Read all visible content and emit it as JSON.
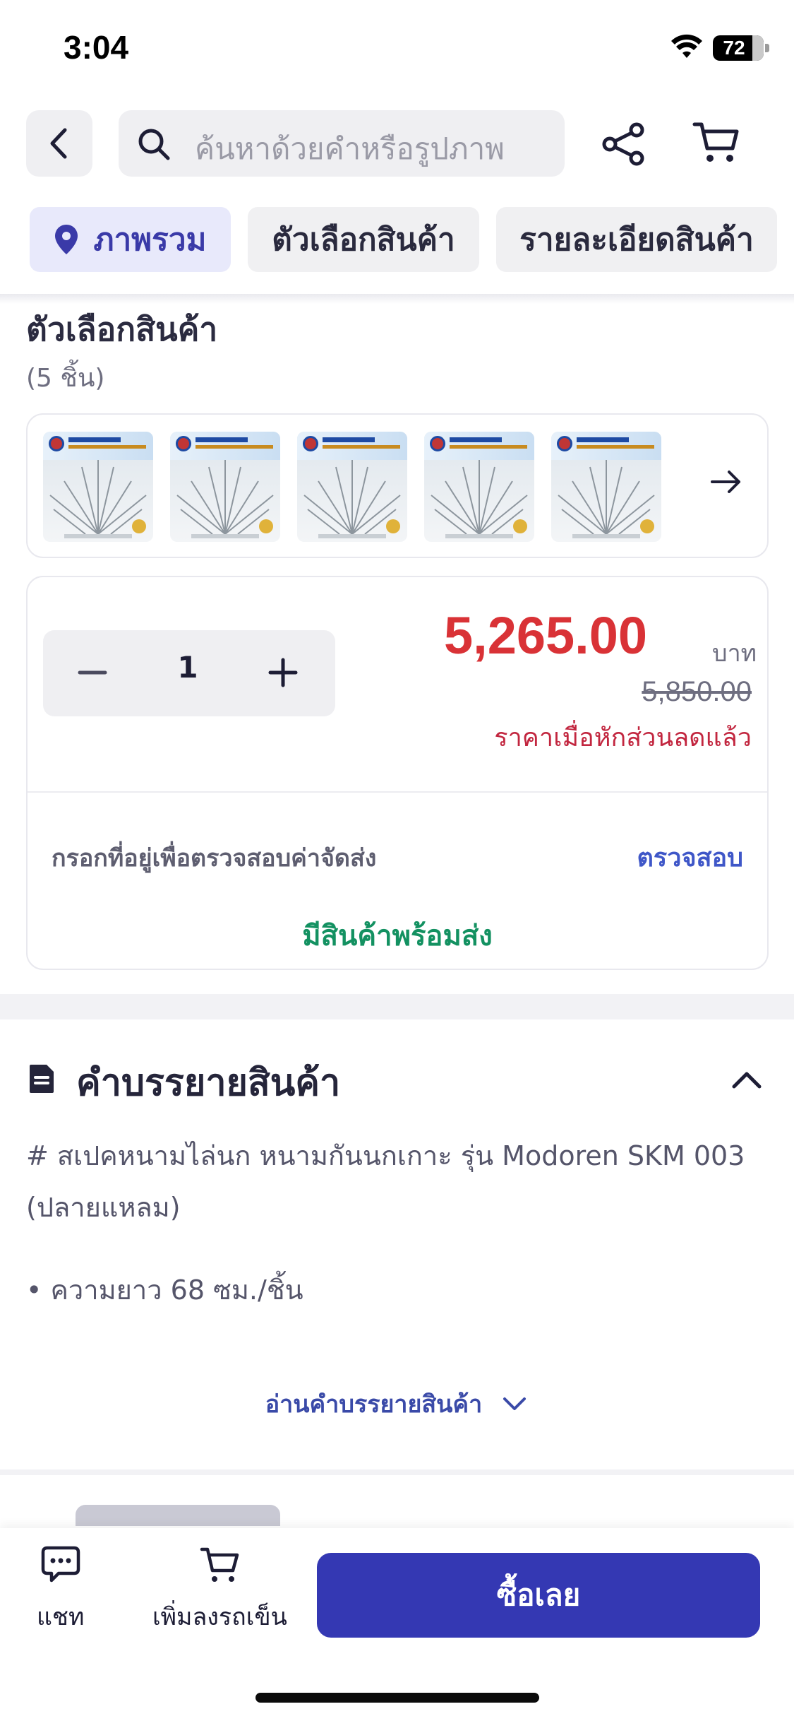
{
  "status_bar": {
    "time": "3:04",
    "battery": "72"
  },
  "search": {
    "placeholder": "ค้นหาด้วยคำหรือรูปภาพ"
  },
  "icons": {
    "back": "chevron-left-icon",
    "search": "search-icon",
    "share": "share-icon",
    "cart": "cart-icon",
    "location": "location-pin-icon",
    "next": "arrow-right-icon",
    "description": "document-icon",
    "chat": "chat-bubble-icon"
  },
  "tabs": [
    {
      "label": "ภาพรวม",
      "active": true
    },
    {
      "label": "ตัวเลือกสินค้า",
      "active": false
    },
    {
      "label": "รายละเอียดสินค้า",
      "active": false
    }
  ],
  "options": {
    "title": "ตัวเลือกสินค้า",
    "count": "(5 ชิ้น)",
    "thumbnails": 5
  },
  "purchase": {
    "quantity": "1",
    "price": "5,265.00",
    "currency": "บาท",
    "original_price": "5,850.00",
    "price_note": "ราคาเมื่อหักส่วนลดแล้ว",
    "shipping_label": "กรอกที่อยู่เพื่อตรวจสอบค่าจัดส่ง",
    "shipping_action": "ตรวจสอบ",
    "stock_status": "มีสินค้าพร้อมส่ง"
  },
  "description": {
    "title": "คำบรรยายสินค้า",
    "line1": "# สเปคหนามไล่นก หนามกันนกเกาะ รุ่น Modoren SKM 003",
    "line2": "(ปลายแหลม)",
    "bullet": "• ความยาว 68 ซม./ชิ้น",
    "read_more": "อ่านคำบรรยายสินค้า"
  },
  "bottom_bar": {
    "chat_label": "แชท",
    "add_to_cart_label": "เพิ่มลงรถเข็น",
    "buy_now_label": "ซื้อเลย"
  },
  "colors": {
    "brand": "#3438b3",
    "price": "#d93236",
    "in_stock": "#139161",
    "link": "#3f57c8"
  }
}
